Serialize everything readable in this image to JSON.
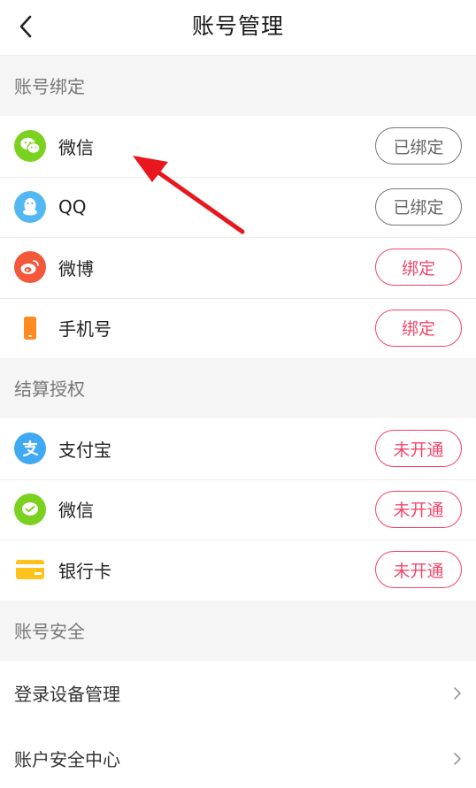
{
  "header": {
    "title": "账号管理"
  },
  "sections": {
    "binding": {
      "title": "账号绑定",
      "items": [
        {
          "label": "微信",
          "action": "已绑定",
          "state": "bound",
          "icon": "wechat-icon",
          "color": "#7bd11f"
        },
        {
          "label": "QQ",
          "action": "已绑定",
          "state": "bound",
          "icon": "qq-icon",
          "color": "#53b8f2"
        },
        {
          "label": "微博",
          "action": "绑定",
          "state": "unbound",
          "icon": "weibo-icon",
          "color": "#f4573a"
        },
        {
          "label": "手机号",
          "action": "绑定",
          "state": "unbound",
          "icon": "phone-icon",
          "color": "#ff8a1f"
        }
      ]
    },
    "settlement": {
      "title": "结算授权",
      "items": [
        {
          "label": "支付宝",
          "action": "未开通",
          "icon": "alipay-icon",
          "color": "#40a9f3"
        },
        {
          "label": "微信",
          "action": "未开通",
          "icon": "wechat-pay-icon",
          "color": "#7bd11f"
        },
        {
          "label": "银行卡",
          "action": "未开通",
          "icon": "bank-card-icon",
          "color": "#ffc21c"
        }
      ]
    },
    "security": {
      "title": "账号安全",
      "items": [
        {
          "label": "登录设备管理"
        },
        {
          "label": "账户安全中心"
        }
      ]
    }
  },
  "colors": {
    "accent": "#f5456a",
    "annotation_arrow": "#e8161d"
  }
}
